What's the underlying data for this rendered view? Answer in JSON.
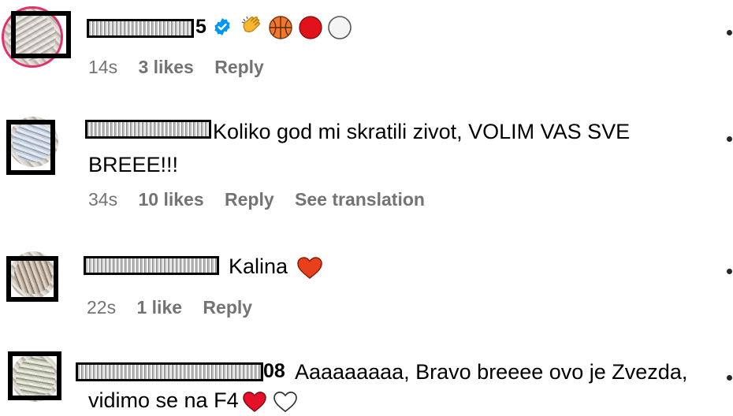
{
  "comments": [
    {
      "username_visible_suffix": "5",
      "verified": true,
      "emojis": [
        "clapping-hands",
        "basketball",
        "red-circle",
        "white-circle"
      ],
      "text": "",
      "time": "14s",
      "likes": "3 likes",
      "reply": "Reply",
      "translation": ""
    },
    {
      "username_visible_suffix": "",
      "verified": false,
      "emojis": [],
      "text": "Koliko god mi skratili zivot, VOLIM VAS SVE BREEE!!!",
      "text_line1": "Koliko god mi skratili zivot, VOLIM VAS SVE",
      "text_line2": "BREEE!!!",
      "time": "34s",
      "likes": "10 likes",
      "reply": "Reply",
      "translation": "See translation"
    },
    {
      "username_visible_suffix": "",
      "verified": false,
      "emojis": [
        "red-heart"
      ],
      "text": "Kalina",
      "time": "22s",
      "likes": "1 like",
      "reply": "Reply",
      "translation": ""
    },
    {
      "username_visible_suffix": "08",
      "verified": false,
      "emojis": [
        "red-heart",
        "white-heart"
      ],
      "text_line1": "Aaaaaaaaa, Bravo breeee ovo je Zvezda,",
      "text_line2": "vidimo se na F4",
      "time": "",
      "likes": "",
      "reply": "",
      "translation": ""
    }
  ],
  "colors": {
    "meta_text": "#737373",
    "verified_blue": "#0095f6",
    "heart_red": "#e0245e",
    "redaction": "#000000"
  }
}
